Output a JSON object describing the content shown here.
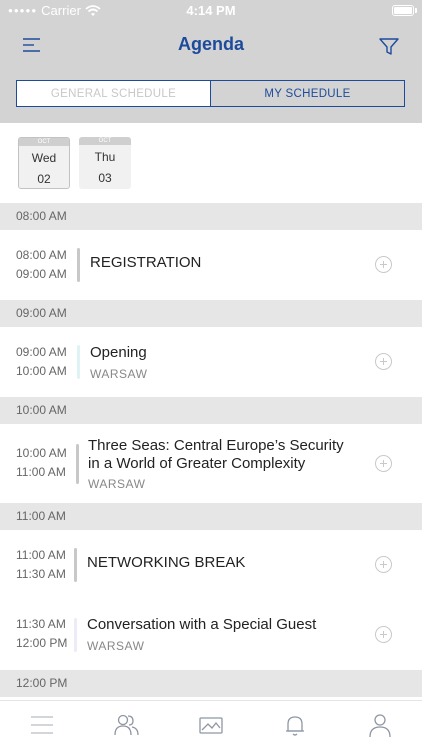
{
  "status_bar": {
    "carrier": "Carrier",
    "time": "4:14 PM"
  },
  "header": {
    "title": "Agenda",
    "menu_icon": "menu-icon",
    "filter_icon": "filter-icon"
  },
  "segments": [
    {
      "label": "GENERAL SCHEDULE",
      "selected": false
    },
    {
      "label": "MY SCHEDULE",
      "selected": true
    }
  ],
  "dates": [
    {
      "month": "OCT",
      "day": "Wed",
      "number": "02",
      "selected": true
    },
    {
      "month": "OCT",
      "day": "Thu",
      "number": "03",
      "selected": false
    }
  ],
  "hours": [
    "08:00 AM",
    "09:00 AM",
    "10:00 AM",
    "11:00 AM",
    "12:00 PM"
  ],
  "sessions": [
    {
      "start": "08:00 AM",
      "end": "09:00 AM",
      "title": "REGISTRATION",
      "location": "",
      "bar_color": "#c8c8c8"
    },
    {
      "start": "09:00 AM",
      "end": "10:00 AM",
      "title": "Opening",
      "location": "WARSAW",
      "bar_color": "#dff3f7"
    },
    {
      "start": "10:00 AM",
      "end": "11:00 AM",
      "title": "Three Seas: Central Europe’s Security in a World of Greater Complexity",
      "location": "WARSAW",
      "bar_color": "#c8c8c8"
    },
    {
      "start": "11:00 AM",
      "end": "11:30 AM",
      "title": "NETWORKING BREAK",
      "location": "",
      "bar_color": "#c8c8c8"
    },
    {
      "start": "11:30 AM",
      "end": "12:00 PM",
      "title": "Conversation with a Special Guest",
      "location": "WARSAW",
      "bar_color": "#ecebf7"
    }
  ],
  "tab_bar": [
    "list-icon",
    "people-icon",
    "gallery-icon",
    "bell-icon",
    "profile-icon"
  ],
  "colors": {
    "accent": "#1d4b9b",
    "header_bg": "#d3d3d3",
    "hour_bg": "#e6e6e6"
  }
}
